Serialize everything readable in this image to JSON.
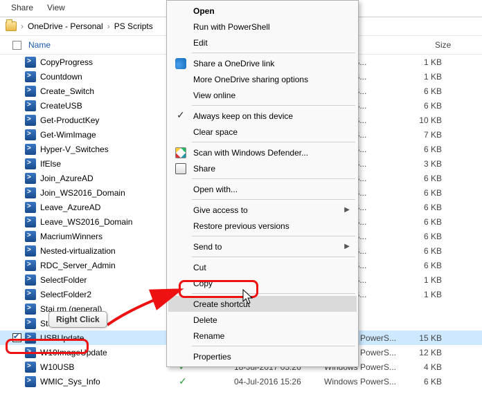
{
  "topbar": {
    "share": "Share",
    "view": "View"
  },
  "breadcrumb": {
    "folder": "OneDrive - Personal",
    "sub": "PS Scripts"
  },
  "columns": {
    "name": "Name",
    "size": "Size"
  },
  "files": [
    {
      "name": "CopyProgress",
      "status": "",
      "date": "",
      "type": "s PowerS...",
      "size": "1 KB",
      "selected": false,
      "chk": false
    },
    {
      "name": "Countdown",
      "status": "",
      "date": "",
      "type": "s PowerS...",
      "size": "1 KB",
      "selected": false,
      "chk": false
    },
    {
      "name": "Create_Switch",
      "status": "",
      "date": "",
      "type": "s PowerS...",
      "size": "6 KB",
      "selected": false,
      "chk": false
    },
    {
      "name": "CreateUSB",
      "status": "",
      "date": "",
      "type": "s PowerS...",
      "size": "6 KB",
      "selected": false,
      "chk": false
    },
    {
      "name": "Get-ProductKey",
      "status": "",
      "date": "",
      "type": "s PowerS...",
      "size": "10 KB",
      "selected": false,
      "chk": false
    },
    {
      "name": "Get-WimImage",
      "status": "",
      "date": "",
      "type": "s PowerS...",
      "size": "7 KB",
      "selected": false,
      "chk": false
    },
    {
      "name": "Hyper-V_Switches",
      "status": "",
      "date": "",
      "type": "s PowerS...",
      "size": "6 KB",
      "selected": false,
      "chk": false
    },
    {
      "name": "IfElse",
      "status": "",
      "date": "",
      "type": "s PowerS...",
      "size": "3 KB",
      "selected": false,
      "chk": false
    },
    {
      "name": "Join_AzureAD",
      "status": "",
      "date": "",
      "type": "s PowerS...",
      "size": "6 KB",
      "selected": false,
      "chk": false
    },
    {
      "name": "Join_WS2016_Domain",
      "status": "",
      "date": "",
      "type": "s PowerS...",
      "size": "6 KB",
      "selected": false,
      "chk": false
    },
    {
      "name": "Leave_AzureAD",
      "status": "",
      "date": "",
      "type": "s PowerS...",
      "size": "6 KB",
      "selected": false,
      "chk": false
    },
    {
      "name": "Leave_WS2016_Domain",
      "status": "",
      "date": "",
      "type": "s PowerS...",
      "size": "6 KB",
      "selected": false,
      "chk": false
    },
    {
      "name": "MacriumWinners",
      "status": "",
      "date": "",
      "type": "s PowerS...",
      "size": "6 KB",
      "selected": false,
      "chk": false
    },
    {
      "name": "Nested-virtualization",
      "status": "",
      "date": "",
      "type": "s PowerS...",
      "size": "6 KB",
      "selected": false,
      "chk": false
    },
    {
      "name": "RDC_Server_Admin",
      "status": "",
      "date": "",
      "type": "s PowerS...",
      "size": "6 KB",
      "selected": false,
      "chk": false
    },
    {
      "name": "SelectFolder",
      "status": "",
      "date": "",
      "type": "s PowerS...",
      "size": "1 KB",
      "selected": false,
      "chk": false
    },
    {
      "name": "SelectFolder2",
      "status": "",
      "date": "",
      "type": "s PowerS...",
      "size": "1 KB",
      "selected": false,
      "chk": false
    },
    {
      "name": "Stai                            rm (general)",
      "status": "",
      "date": "",
      "type": "",
      "size": "",
      "selected": false,
      "chk": false
    },
    {
      "name": "StartVM",
      "status": "",
      "date": "",
      "type": "",
      "size": "",
      "selected": false,
      "chk": false
    },
    {
      "name": "USBUpdate",
      "status": "",
      "date": "31-Oct-2017 23:23",
      "type": "Windows PowerS...",
      "size": "15 KB",
      "selected": true,
      "chk": true
    },
    {
      "name": "W10ImageUpdate",
      "status": "✓",
      "date": "01-Nov-2017 00:41",
      "type": "Windows PowerS...",
      "size": "12 KB",
      "selected": false,
      "chk": false
    },
    {
      "name": "W10USB",
      "status": "✓",
      "date": "18-Jul-2017 05:26",
      "type": "Windows PowerS...",
      "size": "4 KB",
      "selected": false,
      "chk": false
    },
    {
      "name": "WMIC_Sys_Info",
      "status": "✓",
      "date": "04-Jul-2016 15:26",
      "type": "Windows PowerS...",
      "size": "6 KB",
      "selected": false,
      "chk": false
    }
  ],
  "ctx": {
    "open": "Open",
    "runps": "Run with PowerShell",
    "edit": "Edit",
    "shareod": "Share a OneDrive link",
    "moreod": "More OneDrive sharing options",
    "viewonline": "View online",
    "keep": "Always keep on this device",
    "clear": "Clear space",
    "defender": "Scan with Windows Defender...",
    "share": "Share",
    "openwith": "Open with...",
    "giveaccess": "Give access to",
    "restore": "Restore previous versions",
    "sendto": "Send to",
    "cut": "Cut",
    "copy": "Copy",
    "createsc": "Create shortcut",
    "delete": "Delete",
    "rename": "Rename",
    "properties": "Properties"
  },
  "tooltip": "Right Click"
}
